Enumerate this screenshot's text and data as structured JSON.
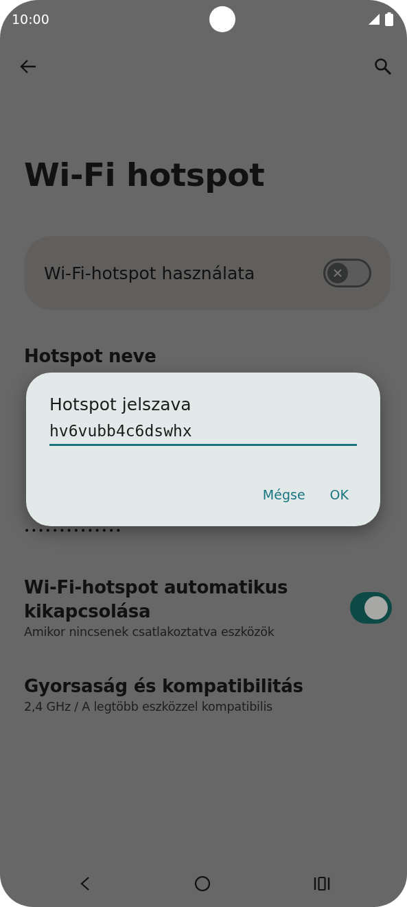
{
  "status_bar": {
    "time": "10:00"
  },
  "title": "Wi-Fi hotspot",
  "main_toggle": {
    "label": "Wi-Fi-hotspot használata",
    "on": false
  },
  "items": [
    {
      "kind": "text",
      "title": "Hotspot neve"
    },
    {
      "kind": "password",
      "dots": "••••••••••••••"
    },
    {
      "kind": "switch",
      "title": "Wi-Fi-hotspot automatikus kikapcsolása",
      "subtitle": "Amikor nincsenek csatlakoztatva eszközök",
      "on": true
    },
    {
      "kind": "text",
      "title": "Gyorsaság és kompatibilitás",
      "subtitle": "2,4 GHz / A legtöbb eszközzel kompatibilis"
    }
  ],
  "dialog": {
    "title": "Hotspot jelszava",
    "value": "hv6vubb4c6dswhx",
    "buttons": [
      "Mégse",
      "OK"
    ]
  }
}
